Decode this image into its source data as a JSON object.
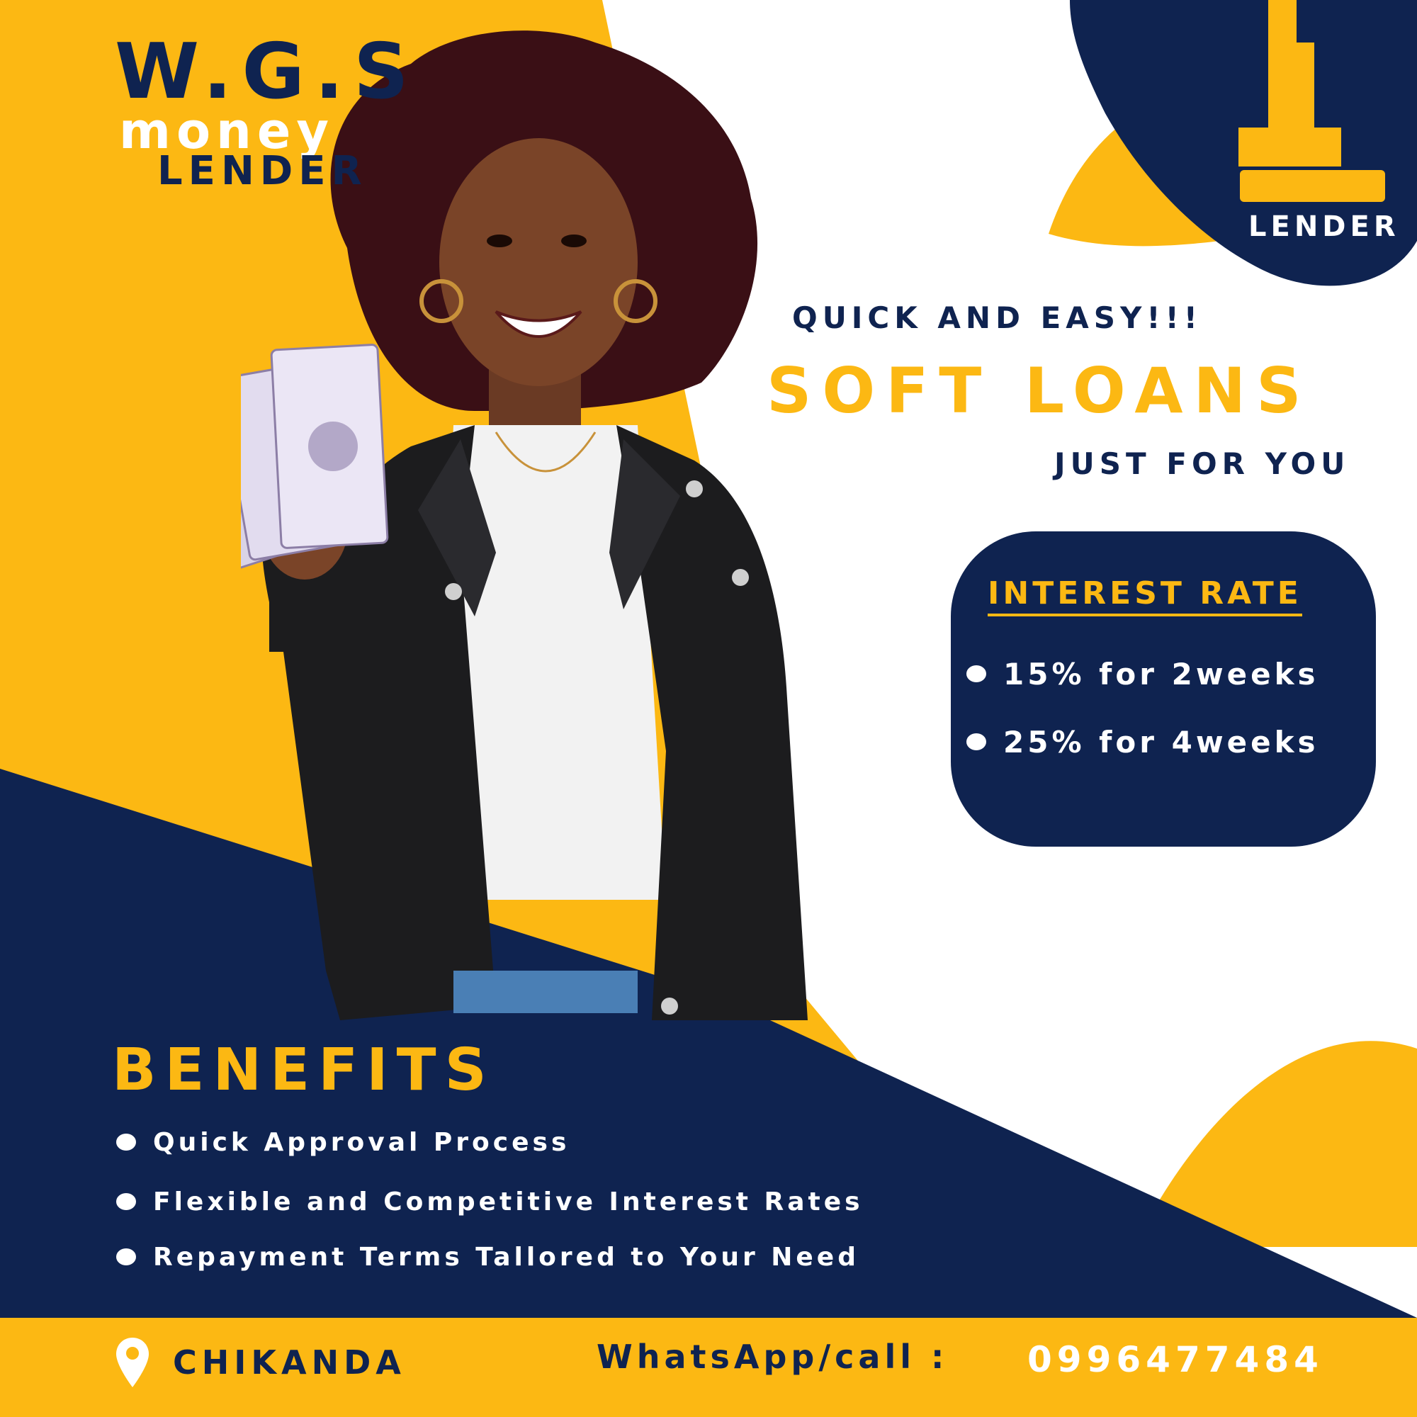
{
  "brand": {
    "name": "W.G.S",
    "line2": "money",
    "line3": "LENDER"
  },
  "logo": {
    "icon": "hand-holding-coin-logo-icon",
    "label": "LENDER"
  },
  "promo": {
    "tagline": "QUICK AND EASY!!!",
    "headline": "SOFT LOANS",
    "subline": "JUST FOR YOU"
  },
  "interest": {
    "title": "INTEREST RATE",
    "rates": [
      "15% for 2weeks",
      "25% for 4weeks"
    ]
  },
  "benefits": {
    "title": "BENEFITS",
    "items": [
      "Quick Approval Process",
      "Flexible and Competitive Interest Rates",
      "Repayment Terms Tallored to Your Need"
    ]
  },
  "footer": {
    "location_icon": "location-pin-icon",
    "location": "CHIKANDA",
    "contact_label": "WhatsApp/call :",
    "contact_number": "0996477484"
  },
  "colors": {
    "navy": "#0f2350",
    "yellow": "#fcb813",
    "white": "#ffffff"
  },
  "photo": {
    "icon": "woman-holding-banknotes-photo"
  }
}
